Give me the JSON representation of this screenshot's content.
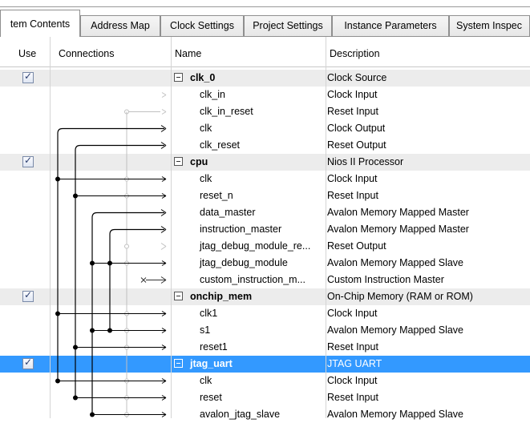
{
  "tabs": [
    {
      "label": "tem Contents",
      "active": true
    },
    {
      "label": "Address Map",
      "active": false
    },
    {
      "label": "Clock Settings",
      "active": false
    },
    {
      "label": "Project Settings",
      "active": false
    },
    {
      "label": "Instance Parameters",
      "active": false
    },
    {
      "label": "System Inspec",
      "active": false
    }
  ],
  "columns": {
    "use": "Use",
    "connections": "Connections",
    "name": "Name",
    "description": "Description"
  },
  "colors": {
    "selection": "#3399ff",
    "group_row": "#ececec",
    "active_wire": "#000000",
    "inactive_wire": "#c0c0c0"
  },
  "rows": [
    {
      "type": "group",
      "name": "clk_0",
      "description": "Clock Source",
      "checked": true
    },
    {
      "type": "child",
      "name": "clk_in",
      "description": "Clock Input"
    },
    {
      "type": "child",
      "name": "clk_in_reset",
      "description": "Reset Input"
    },
    {
      "type": "child",
      "name": "clk",
      "description": "Clock Output"
    },
    {
      "type": "child",
      "name": "clk_reset",
      "description": "Reset Output"
    },
    {
      "type": "group",
      "name": "cpu",
      "description": "Nios II Processor",
      "checked": true
    },
    {
      "type": "child",
      "name": "clk",
      "description": "Clock Input"
    },
    {
      "type": "child",
      "name": "reset_n",
      "description": "Reset Input"
    },
    {
      "type": "child",
      "name": "data_master",
      "description": "Avalon Memory Mapped Master"
    },
    {
      "type": "child",
      "name": "instruction_master",
      "description": "Avalon Memory Mapped Master"
    },
    {
      "type": "child",
      "name": "jtag_debug_module_re...",
      "description": "Reset Output"
    },
    {
      "type": "child",
      "name": "jtag_debug_module",
      "description": "Avalon Memory Mapped Slave"
    },
    {
      "type": "child",
      "name": "custom_instruction_m...",
      "description": "Custom Instruction Master"
    },
    {
      "type": "group",
      "name": "onchip_mem",
      "description": "On-Chip Memory (RAM or ROM)",
      "checked": true
    },
    {
      "type": "child",
      "name": "clk1",
      "description": "Clock Input"
    },
    {
      "type": "child",
      "name": "s1",
      "description": "Avalon Memory Mapped Slave"
    },
    {
      "type": "child",
      "name": "reset1",
      "description": "Reset Input"
    },
    {
      "type": "group",
      "name": "jtag_uart",
      "description": "JTAG UART",
      "checked": true,
      "selected": true
    },
    {
      "type": "child",
      "name": "clk",
      "description": "Clock Input"
    },
    {
      "type": "child",
      "name": "reset",
      "description": "Reset Input"
    },
    {
      "type": "child",
      "name": "avalon_jtag_slave",
      "description": "Avalon Memory Mapped Slave"
    }
  ]
}
